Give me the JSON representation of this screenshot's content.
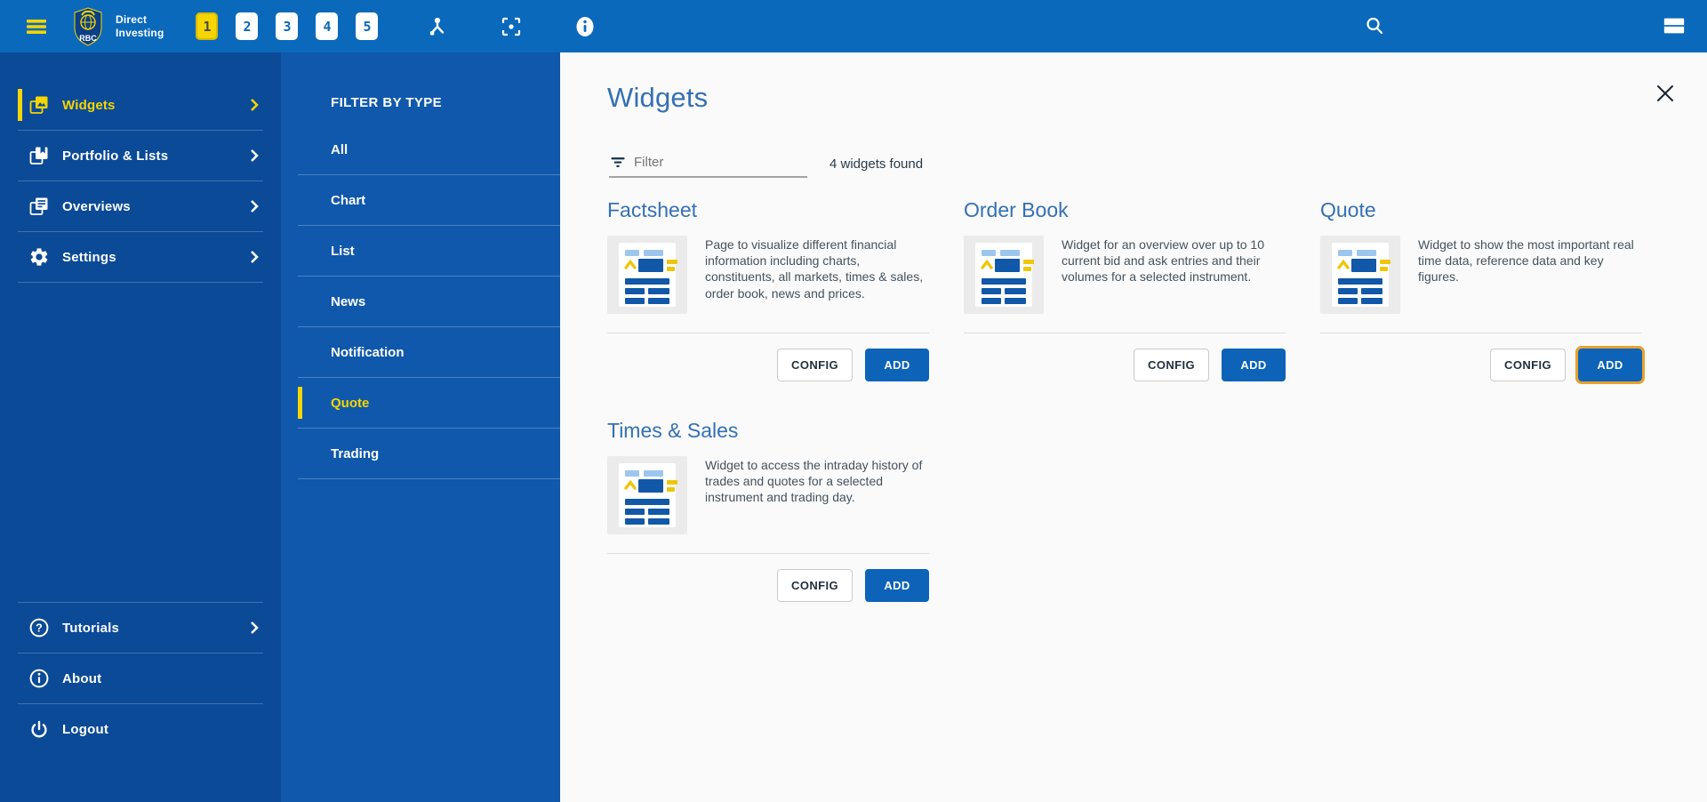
{
  "topbar": {
    "logo": {
      "shield_text": "RBC",
      "name_line1": "Direct",
      "name_line2": "Investing"
    },
    "tabs": [
      {
        "label": "1",
        "active": true
      },
      {
        "label": "2",
        "active": false
      },
      {
        "label": "3",
        "active": false
      },
      {
        "label": "4",
        "active": false
      },
      {
        "label": "5",
        "active": false
      }
    ],
    "action_icons": [
      "hamburger-menu-icon",
      "tools-icon",
      "scan-icon",
      "info-icon",
      "search-icon",
      "layout-icon"
    ]
  },
  "sidebar": {
    "items": [
      {
        "label": "Widgets",
        "icon": "widgets-icon",
        "active": true,
        "chevron": true
      },
      {
        "label": "Portfolio & Lists",
        "icon": "portfolio-icon",
        "active": false,
        "chevron": true
      },
      {
        "label": "Overviews",
        "icon": "overviews-icon",
        "active": false,
        "chevron": true
      },
      {
        "label": "Settings",
        "icon": "settings-gear-icon",
        "active": false,
        "chevron": true
      }
    ],
    "footer_items": [
      {
        "label": "Tutorials",
        "icon": "help-circle-icon",
        "chevron": true
      },
      {
        "label": "About",
        "icon": "info-circle-icon",
        "chevron": false
      },
      {
        "label": "Logout",
        "icon": "power-icon",
        "chevron": false
      }
    ]
  },
  "filter_panel": {
    "title": "FILTER BY TYPE",
    "options": [
      {
        "label": "All",
        "active": false
      },
      {
        "label": "Chart",
        "active": false
      },
      {
        "label": "List",
        "active": false
      },
      {
        "label": "News",
        "active": false
      },
      {
        "label": "Notification",
        "active": false
      },
      {
        "label": "Quote",
        "active": true
      },
      {
        "label": "Trading",
        "active": false
      }
    ]
  },
  "main": {
    "title": "Widgets",
    "filter_input": {
      "placeholder": "Filter",
      "value": ""
    },
    "results_count": "4 widgets found",
    "cards": [
      {
        "title": "Factsheet",
        "description": "Page to visualize different financial information including charts, constituents, all markets, times & sales, order book, news and prices.",
        "config_label": "CONFIG",
        "add_label": "ADD",
        "add_highlighted": false
      },
      {
        "title": "Order Book",
        "description": "Widget for an overview over up to 10 current bid and ask entries and their volumes for a selected instrument.",
        "config_label": "CONFIG",
        "add_label": "ADD",
        "add_highlighted": false
      },
      {
        "title": "Quote",
        "description": "Widget to show the most important real time data, reference data and key figures.",
        "config_label": "CONFIG",
        "add_label": "ADD",
        "add_highlighted": true
      },
      {
        "title": "Times & Sales",
        "description": "Widget to access the intraday history of trades and quotes for a selected instrument and trading day.",
        "config_label": "CONFIG",
        "add_label": "ADD",
        "add_highlighted": false
      }
    ]
  },
  "colors": {
    "topbar_blue": "#0b69bb",
    "sidebar_blue": "#0b4a97",
    "panel_blue": "#0f58ac",
    "accent_yellow": "#f6d500",
    "primary_button_blue": "#0c63b8",
    "highlight_gold": "#e8a22e",
    "title_blue": "#3470b4"
  }
}
